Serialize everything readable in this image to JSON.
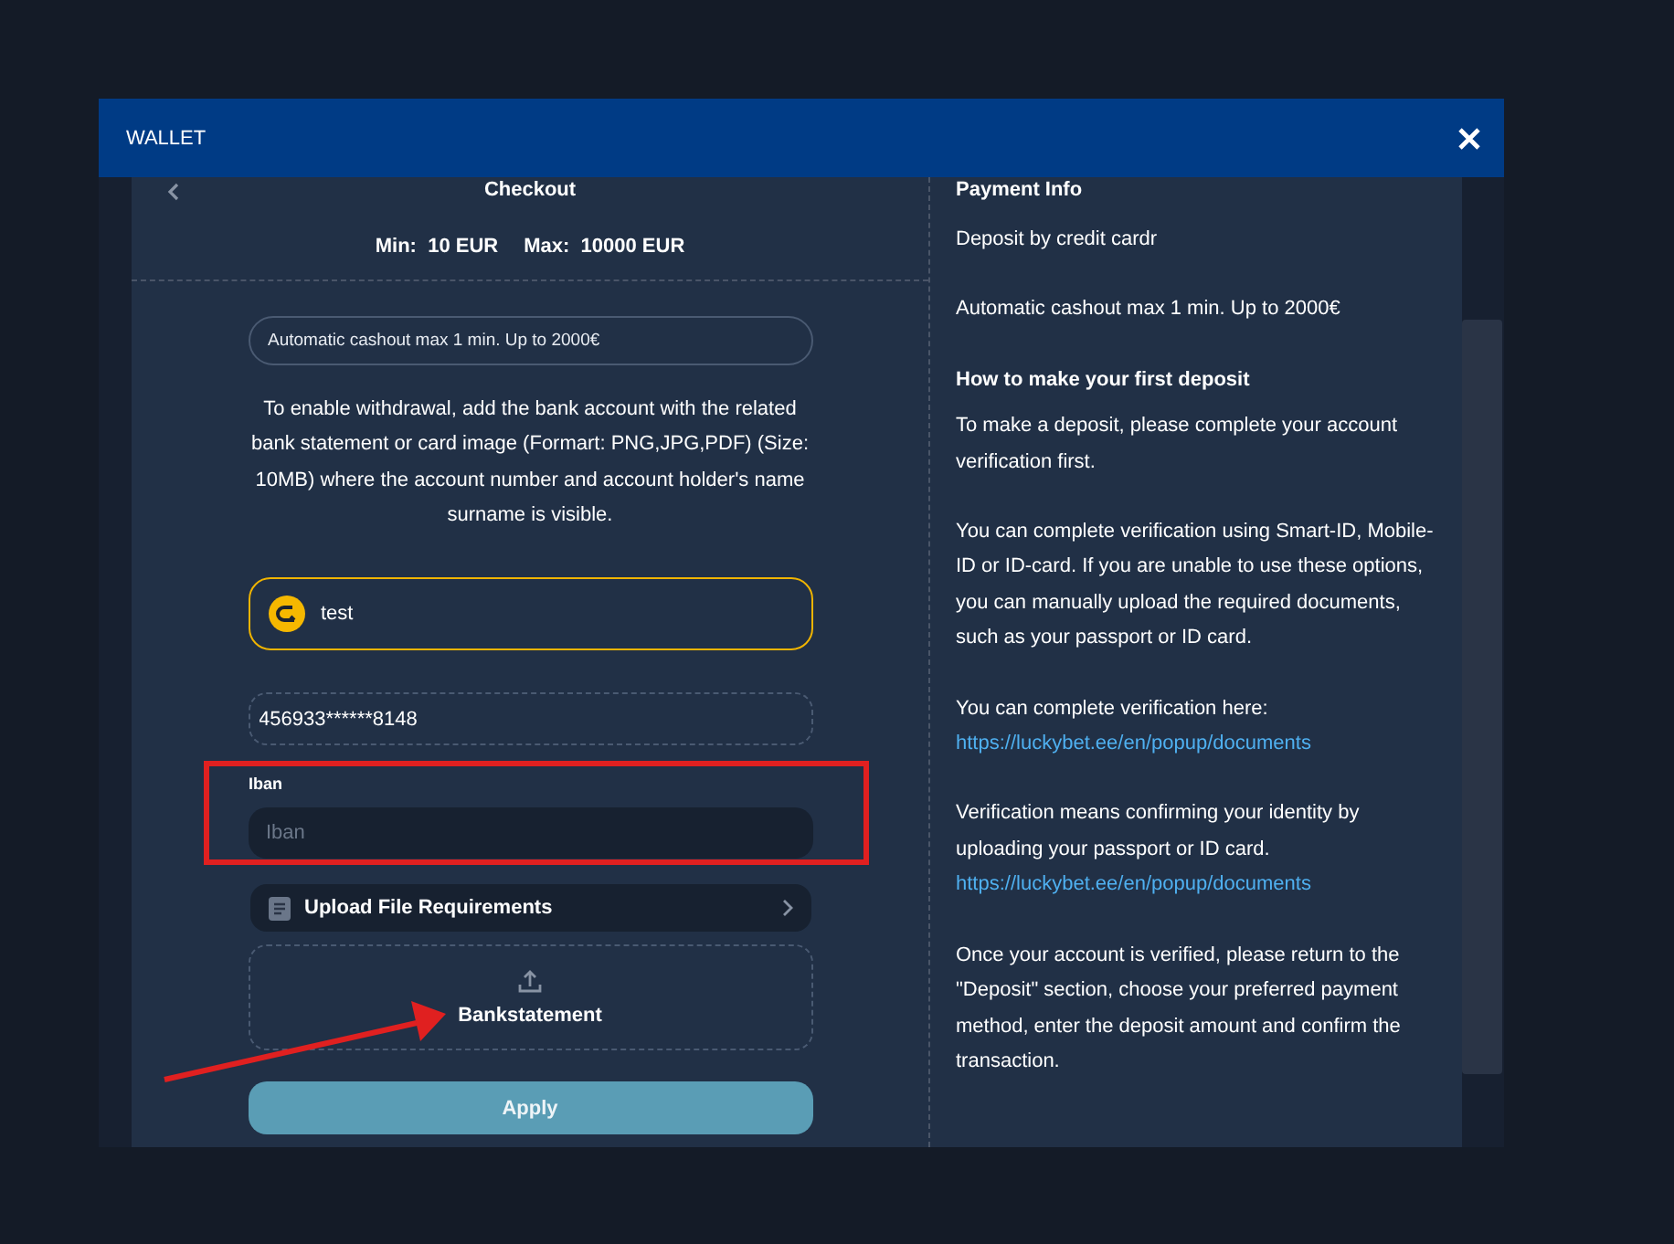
{
  "window": {
    "title": "WALLET"
  },
  "checkout": {
    "title": "Checkout",
    "min_label": "Min:",
    "min_value": "10 EUR",
    "max_label": "Max:",
    "max_value": "10000 EUR"
  },
  "notice": "Automatic cashout max 1 min. Up to 2000€",
  "instructions": "To enable withdrawal, add the bank account with the related bank statement or card image (Formart: PNG,JPG,PDF) (Size: 10MB) where the account number and account holder's name surname is visible.",
  "method": {
    "name": "test",
    "selected": true
  },
  "card_field": {
    "value": "456933******8148"
  },
  "iban_field": {
    "label": "Iban",
    "placeholder": "Iban"
  },
  "requirements_row": {
    "label": "Upload File Requirements"
  },
  "upload": {
    "label": "Bankstatement"
  },
  "apply_button": {
    "label": "Apply",
    "disabled": true
  },
  "payment_info": {
    "title": "Payment Info",
    "blocks": [
      {
        "kind": "text",
        "text": "Deposit by credit cardr"
      },
      {
        "kind": "text",
        "text": "Automatic cashout max 1 min. Up to 2000€"
      },
      {
        "kind": "heading",
        "text": "How to make your first deposit"
      },
      {
        "kind": "text",
        "text": "To make a deposit, please complete your account verification first."
      },
      {
        "kind": "text",
        "text": "You can complete verification using Smart-ID, Mobile-ID or ID-card. If you are unable to use these options, you can manually upload the required documents, such as your passport or ID card."
      },
      {
        "kind": "text",
        "text": "You can complete verification here:",
        "link": "https://luckybet.ee/en/popup/documents"
      },
      {
        "kind": "text",
        "text": "Verification means confirming your identity by uploading your passport or ID card.",
        "link": "https://luckybet.ee/en/popup/documents"
      },
      {
        "kind": "text",
        "text": "Once your account is verified, please return to the \"Deposit\" section, choose your preferred payment method, enter the deposit amount and confirm the transaction."
      }
    ]
  },
  "annotations": {
    "box_around_iban": true,
    "arrow_to_upload": true
  }
}
